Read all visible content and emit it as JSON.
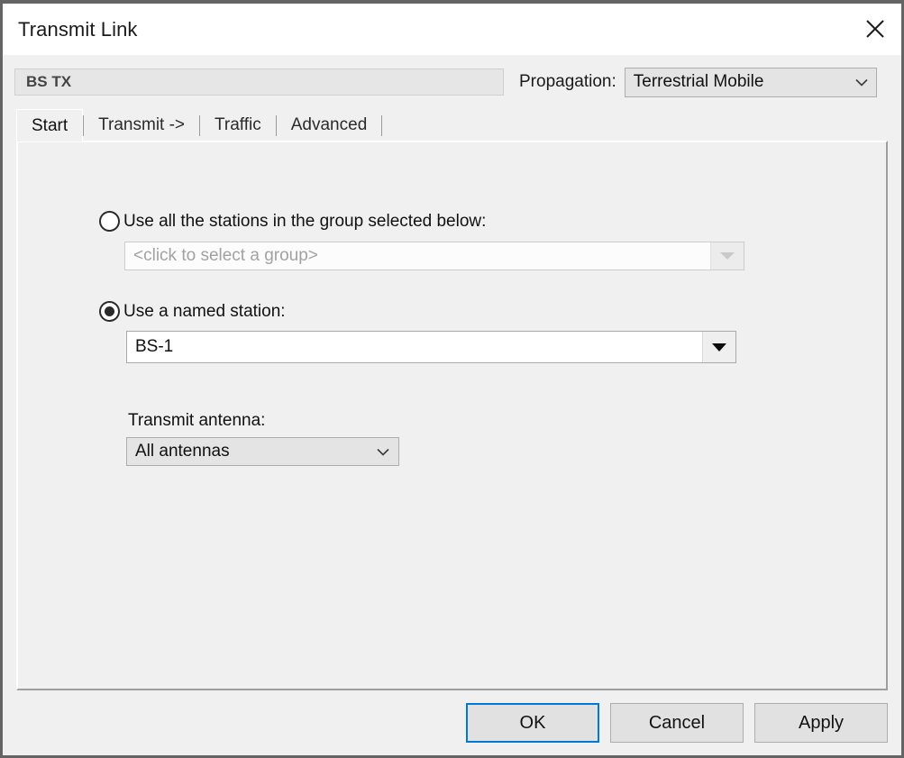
{
  "window": {
    "title": "Transmit Link",
    "close_icon": "close-icon"
  },
  "header": {
    "name_value": "BS TX",
    "propagation_label": "Propagation:",
    "propagation_value": "Terrestrial Mobile",
    "propagation_icon": "chevron-down-icon"
  },
  "tabs": [
    {
      "label": "Start",
      "active": true
    },
    {
      "label": "Transmit ->",
      "active": false
    },
    {
      "label": "Traffic",
      "active": false
    },
    {
      "label": "Advanced",
      "active": false
    }
  ],
  "panel": {
    "option_group": {
      "label": "Use all the stations in the group selected below:",
      "selected": false,
      "combo_placeholder": "<click to select a group>",
      "combo_value": "",
      "combo_icon": "triangle-down-icon",
      "enabled": false
    },
    "option_station": {
      "label": "Use a named station:",
      "selected": true,
      "combo_value": "BS-1",
      "combo_icon": "triangle-down-icon",
      "enabled": true
    },
    "antenna": {
      "label": "Transmit antenna:",
      "value": "All antennas",
      "icon": "chevron-down-icon"
    }
  },
  "footer": {
    "ok_label": "OK",
    "cancel_label": "Cancel",
    "apply_label": "Apply"
  },
  "colors": {
    "accent": "#0078d7",
    "dialog_bg": "#f0f0f0",
    "titlebar_bg": "#ffffff"
  }
}
